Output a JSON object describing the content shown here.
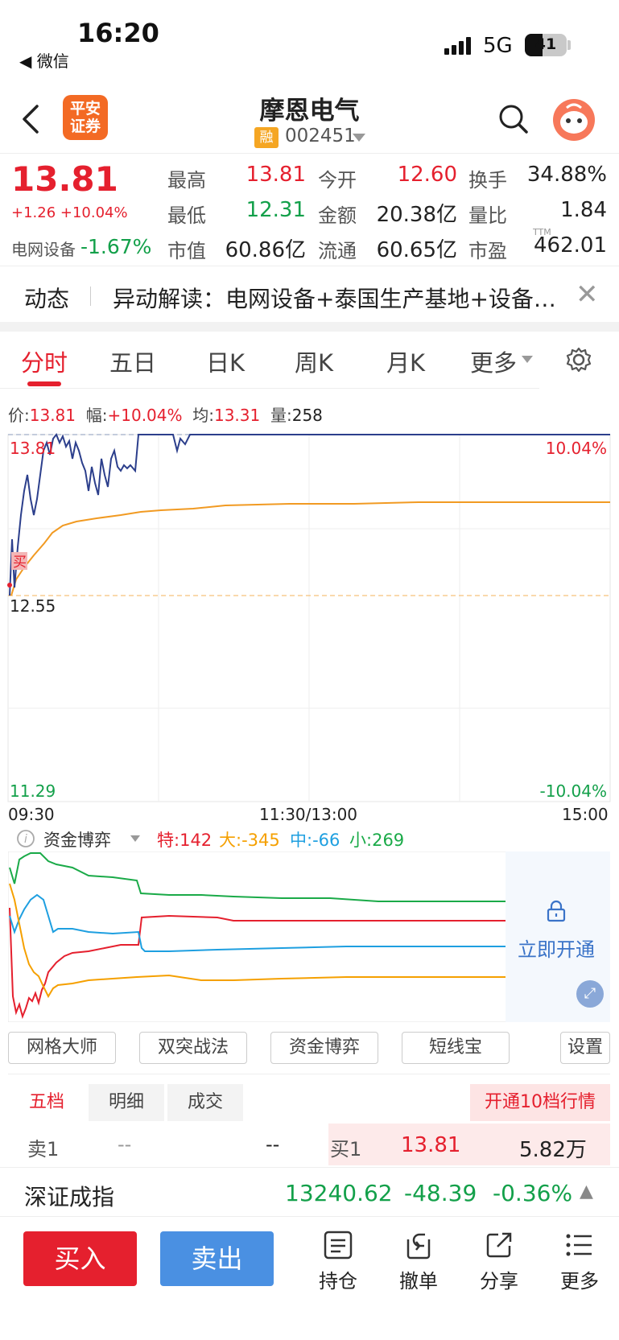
{
  "status_bar": {
    "time": "16:20",
    "back_app": "◀ 微信",
    "network": "5G",
    "battery": "41"
  },
  "header": {
    "brand_line1": "平安",
    "brand_line2": "证券",
    "stock_name": "摩恩电气",
    "margin_badge": "融",
    "stock_code": "002451"
  },
  "quote": {
    "price": "13.81",
    "change": "+1.26 +10.04%",
    "sector_name": "电网设备",
    "sector_change": "-1.67%",
    "rows": [
      [
        {
          "label": "最高",
          "value": "13.81",
          "color": "red"
        },
        {
          "label": "今开",
          "value": "12.60",
          "color": "red"
        },
        {
          "label": "换手",
          "value": "34.88%",
          "color": "black"
        }
      ],
      [
        {
          "label": "最低",
          "value": "12.31",
          "color": "green"
        },
        {
          "label": "金额",
          "value": "20.38亿",
          "color": "black"
        },
        {
          "label": "量比",
          "value": "1.84",
          "color": "black"
        }
      ],
      [
        {
          "label": "市值",
          "value": "60.86亿",
          "color": "black"
        },
        {
          "label": "流通",
          "value": "60.65亿",
          "color": "black"
        },
        {
          "label": "市盈",
          "value": "462.01",
          "color": "black"
        }
      ]
    ],
    "ttm": "TTM"
  },
  "news": {
    "tag": "动态",
    "text": "异动解读：电网设备+泰国生产基地+设备…"
  },
  "tabs": [
    "分时",
    "五日",
    "日K",
    "周K",
    "月K",
    "更多"
  ],
  "info_row": {
    "price_label": "价:",
    "price": "13.81",
    "amp_label": "幅:",
    "amp": "+10.04%",
    "avg_label": "均:",
    "avg": "13.31",
    "vol_label": "量:",
    "vol": "258"
  },
  "intraday": {
    "y_top": "13.81",
    "y_mid": "12.55",
    "y_bottom": "11.29",
    "pct_top": "10.04%",
    "pct_bottom": "-10.04%",
    "t_start": "09:30",
    "t_mid": "11:30/13:00",
    "t_end": "15:00",
    "buy_marker": "买"
  },
  "fund_flow": {
    "title": "资金博弈",
    "special_label": "特:",
    "special": "142",
    "large_label": "大:",
    "large": "-345",
    "medium_label": "中:",
    "medium": "-66",
    "small_label": "小:",
    "small": "269",
    "unlock": "立即开通",
    "colors": {
      "special": "#e5202e",
      "large": "#f5a000",
      "medium": "#1e9fe0",
      "small": "#1aaa48"
    }
  },
  "tools": [
    "网格大师",
    "双突战法",
    "资金博弈",
    "短线宝",
    "设置"
  ],
  "order_book": {
    "tabs": [
      "五档",
      "明细",
      "成交"
    ],
    "upgrade": "开通10档行情",
    "sell1": {
      "label": "卖1",
      "price": "--",
      "vol": "--"
    },
    "buy1": {
      "label": "买1",
      "price": "13.81",
      "vol": "5.82万"
    }
  },
  "index_bar": {
    "name": "深证成指",
    "value": "13240.62",
    "change": "-48.39",
    "pct": "-0.36%"
  },
  "bottom_bar": {
    "buy": "买入",
    "sell": "卖出",
    "holdings": "持仓",
    "cancel": "撤单",
    "share": "分享",
    "more": "更多"
  }
}
